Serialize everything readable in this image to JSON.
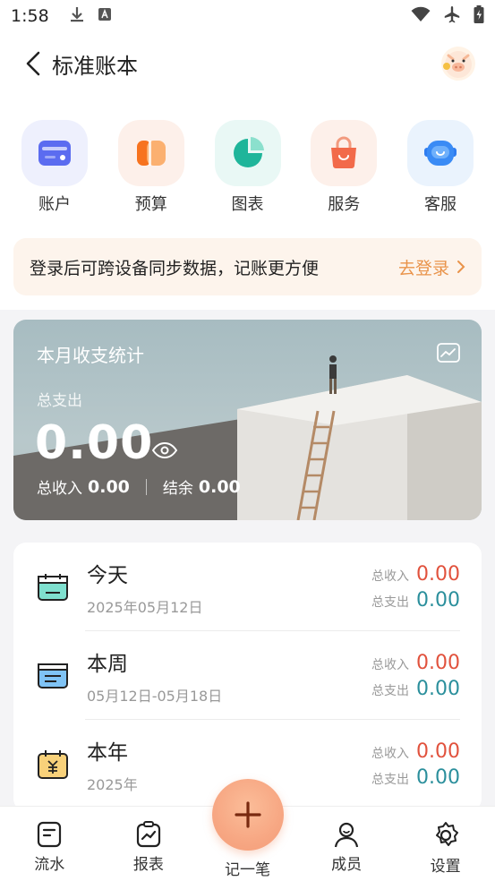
{
  "status_bar": {
    "time": "1:58",
    "left_icons": [
      "download-icon",
      "font-a-icon"
    ],
    "right_icons": [
      "wifi-icon",
      "airplane-icon",
      "battery-charging-icon"
    ]
  },
  "header": {
    "title": "标准账本",
    "avatar_icon": "pig-avatar-icon"
  },
  "quick_actions": [
    {
      "label": "账户",
      "icon": "wallet-icon",
      "bg": "#eef0fd"
    },
    {
      "label": "预算",
      "icon": "budget-icon",
      "bg": "#fdf0ea"
    },
    {
      "label": "图表",
      "icon": "pie-chart-icon",
      "bg": "#e9f8f5"
    },
    {
      "label": "服务",
      "icon": "shopping-bag-icon",
      "bg": "#fdf0ea"
    },
    {
      "label": "客服",
      "icon": "robot-icon",
      "bg": "#eaf3fd"
    }
  ],
  "login_banner": {
    "text": "登录后可跨设备同步数据，记账更方便",
    "link": "去登录"
  },
  "monthly_stats": {
    "title": "本月收支统计",
    "total_label": "总支出",
    "total_value": "0.00",
    "income_label": "总收入",
    "income_value": "0.00",
    "balance_label": "结余",
    "balance_value": "0.00"
  },
  "summary": {
    "income_label": "总收入",
    "expense_label": "总支出",
    "rows": [
      {
        "title": "今天",
        "date": "2025年05月12日",
        "income": "0.00",
        "expense": "0.00",
        "icon": "calendar-today-icon"
      },
      {
        "title": "本周",
        "date": "05月12日-05月18日",
        "income": "0.00",
        "expense": "0.00",
        "icon": "calendar-week-icon"
      },
      {
        "title": "本年",
        "date": "2025年",
        "income": "0.00",
        "expense": "0.00",
        "icon": "calendar-year-icon"
      }
    ]
  },
  "bottom_nav": [
    {
      "label": "流水",
      "icon": "ledger-icon"
    },
    {
      "label": "报表",
      "icon": "report-icon"
    },
    {
      "label": "记一笔",
      "icon": "add-icon"
    },
    {
      "label": "成员",
      "icon": "member-icon"
    },
    {
      "label": "设置",
      "icon": "settings-icon"
    }
  ],
  "colors": {
    "accent": "#e9934a",
    "income": "#e1523d",
    "expense": "#2b8f9c",
    "fab": "#f7a783"
  }
}
